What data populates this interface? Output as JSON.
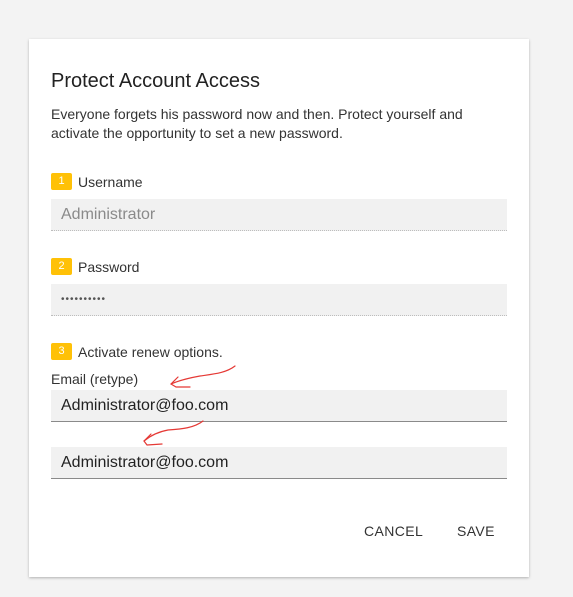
{
  "dialog": {
    "title": "Protect Account Access",
    "description": "Everyone forgets his password now and then. Protect yourself and activate the opportunity to set a new password."
  },
  "steps": [
    {
      "number": "1",
      "label": "Username"
    },
    {
      "number": "2",
      "label": "Password"
    },
    {
      "number": "3",
      "label": "Activate renew options."
    }
  ],
  "username": {
    "value": "Administrator"
  },
  "password": {
    "value": "••••••••••"
  },
  "email": {
    "label": "Email (retype)",
    "value": "Administrator@foo.com",
    "retype_value": "Administrator@foo.com"
  },
  "actions": {
    "cancel_label": "CANCEL",
    "save_label": "SAVE"
  },
  "colors": {
    "badge": "#ffc107",
    "annotation": "#e53935"
  },
  "icons": [
    "hand-drawn-arrow-icon"
  ]
}
